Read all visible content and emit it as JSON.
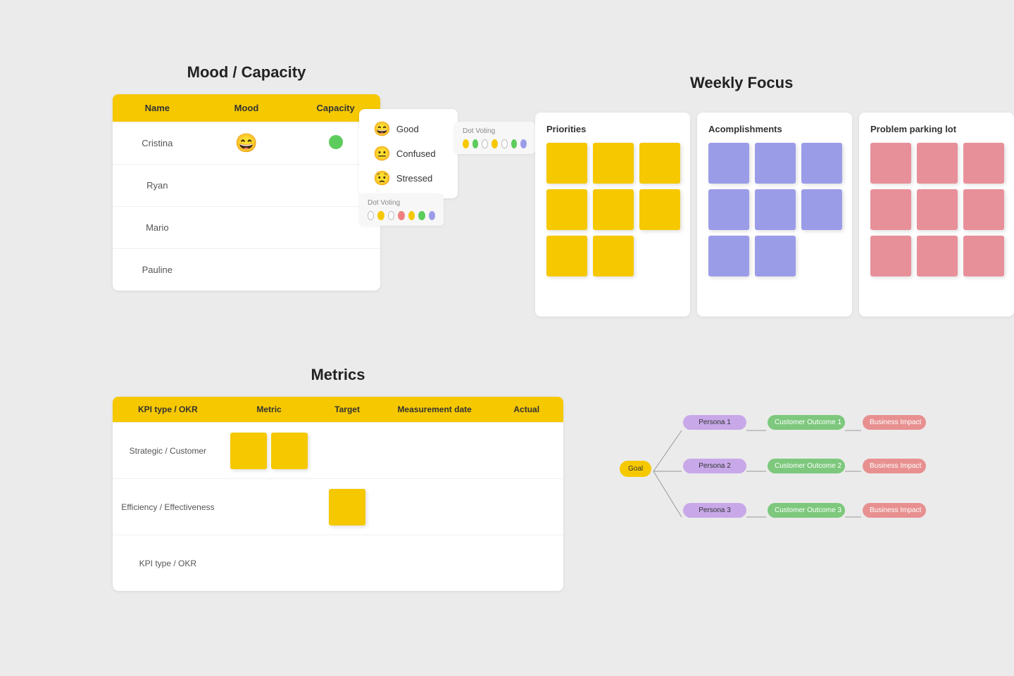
{
  "mood_section": {
    "title": "Mood / Capacity",
    "table": {
      "headers": [
        "Name",
        "Mood",
        "Capacity"
      ],
      "rows": [
        {
          "name": "Cristina",
          "mood": "😄",
          "capacity": "green"
        },
        {
          "name": "Ryan",
          "mood": "",
          "capacity": ""
        },
        {
          "name": "Mario",
          "mood": "",
          "capacity": ""
        },
        {
          "name": "Pauline",
          "mood": "",
          "capacity": ""
        }
      ]
    }
  },
  "mood_legend": {
    "items": [
      {
        "emoji": "😄",
        "label": "Good"
      },
      {
        "emoji": "😐",
        "label": "Confused"
      },
      {
        "emoji": "😟",
        "label": "Stressed"
      }
    ]
  },
  "dot_voting_top": {
    "label": "Dot Voting",
    "dots": [
      "empty",
      "yellow",
      "empty",
      "yellow",
      "yellow",
      "green",
      "purple"
    ]
  },
  "dot_voting_legend": {
    "label": "Dot Voting",
    "dots": [
      "empty",
      "yellow",
      "empty",
      "pink",
      "yellow",
      "green",
      "purple"
    ]
  },
  "weekly_focus": {
    "title": "Weekly Focus",
    "panels": [
      {
        "id": "priorities",
        "title": "Priorities",
        "sticky_color": "yellow",
        "count": 8
      },
      {
        "id": "accomplishments",
        "title": "Acomplishments",
        "sticky_color": "purple",
        "count": 8
      },
      {
        "id": "problem",
        "title": "Problem parking lot",
        "sticky_color": "pink",
        "count": 9
      }
    ]
  },
  "metrics": {
    "title": "Metrics",
    "headers": [
      "KPI type / OKR",
      "Metric",
      "Target",
      "Measurement date",
      "Actual"
    ],
    "rows": [
      {
        "label": "Strategic / Customer",
        "has_stickies": true,
        "sticky_count": 2
      },
      {
        "label": "Efficiency / Effectiveness",
        "has_stickies": true,
        "sticky_count": 1,
        "sticky_col": 2
      },
      {
        "label": "KPI type / OKR",
        "has_stickies": false,
        "sticky_count": 0
      }
    ]
  },
  "flow_diagram": {
    "goal": "Goal",
    "personas": [
      "Persona 1",
      "Persona 2",
      "Persona 3"
    ],
    "outcomes": [
      "Customer Outcome 1",
      "Customer Outcome 2",
      "Customer Outcome 3"
    ],
    "impacts": [
      "Business Impact",
      "Business Impact",
      "Business Impact"
    ]
  }
}
